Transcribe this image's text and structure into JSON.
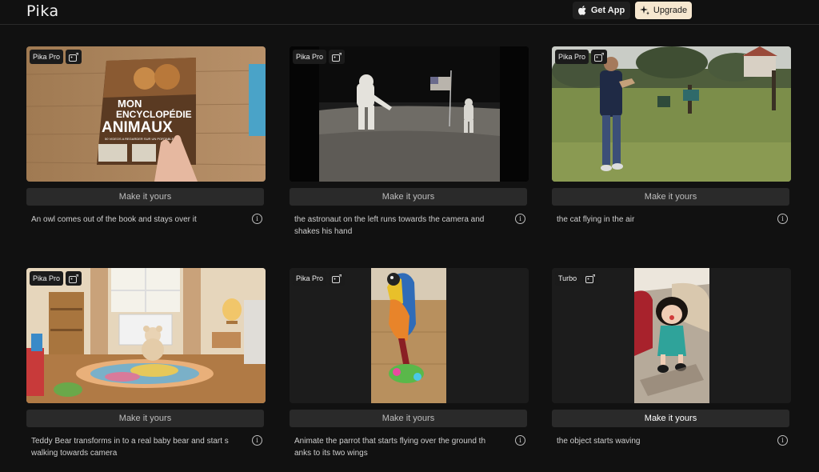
{
  "header": {
    "logo": "Pika",
    "get_app_label": "Get App",
    "upgrade_label": "Upgrade"
  },
  "cards": [
    {
      "tag": "Pika Pro",
      "button": "Make it yours",
      "prompt": "An owl comes out of the book and stays over it",
      "thumb_book_title_1": "MON",
      "thumb_book_title_2": "ENCYCLOPÉDIE",
      "thumb_book_title_3": "ANIMAUX",
      "thumb_book_sub": "50 VIDEOS A REGARDER SUR UN PORTABLE"
    },
    {
      "tag": "Pika Pro",
      "button": "Make it yours",
      "prompt": "the astronaut on the left runs towards the camera and shakes his hand"
    },
    {
      "tag": "Pika Pro",
      "button": "Make it yours",
      "prompt": "the cat flying in the air"
    },
    {
      "tag": "Pika Pro",
      "button": "Make it yours",
      "prompt": "Teddy Bear transforms in to a real baby bear and start s walking towards camera"
    },
    {
      "tag": "Pika Pro",
      "button": "Make it yours",
      "prompt": "Animate the parrot that starts flying over the ground th anks to its two wings"
    },
    {
      "tag": "Turbo",
      "button": "Make it yours",
      "prompt": "the object starts waving"
    }
  ],
  "colors": {
    "background": "#111111",
    "card_button": "#2a2a2a",
    "upgrade_button": "#f6e7cf"
  }
}
